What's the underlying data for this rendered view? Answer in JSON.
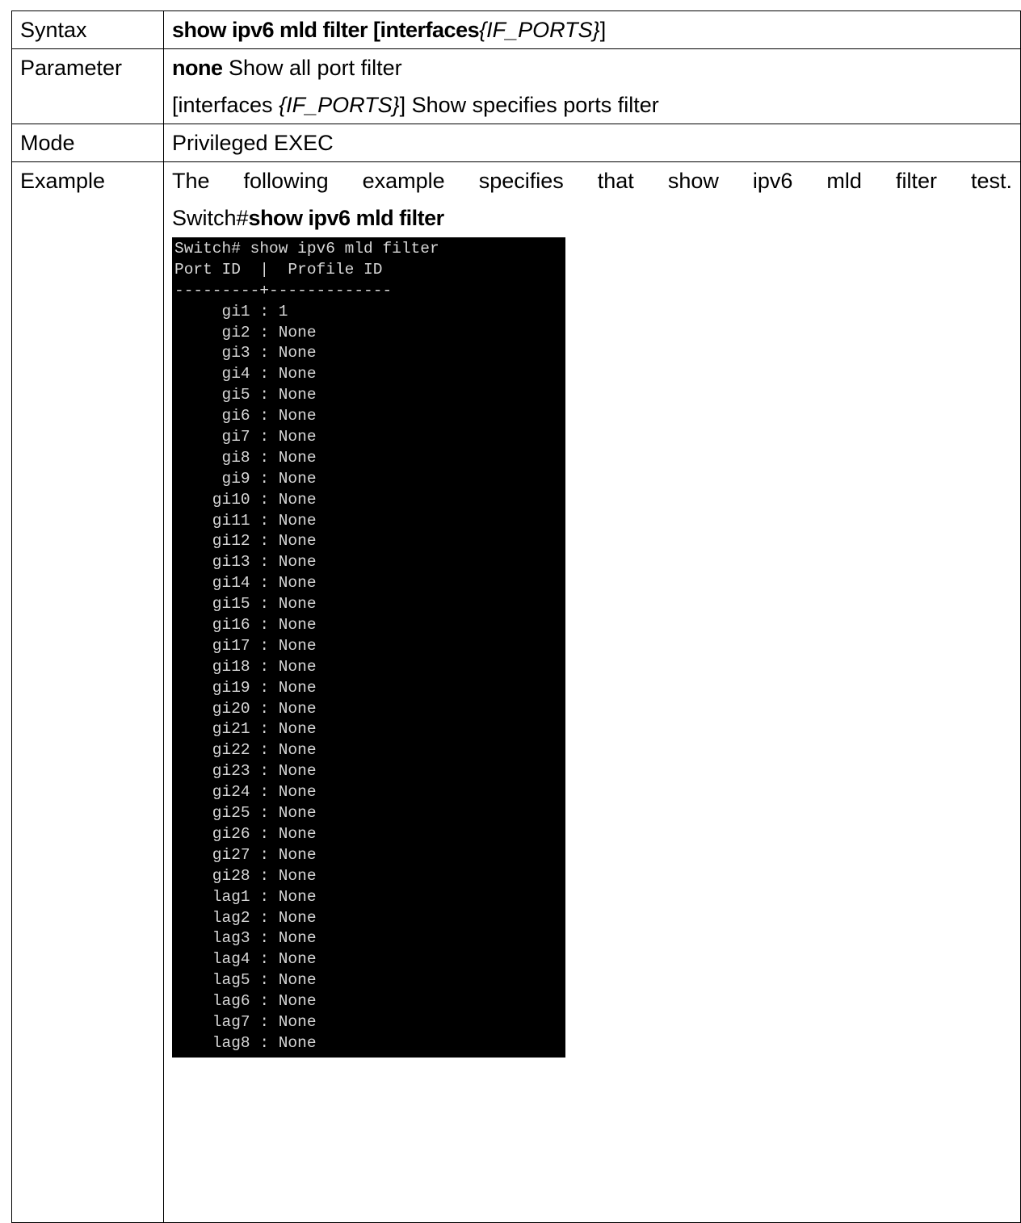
{
  "rows": {
    "syntax": {
      "label": "Syntax",
      "cmd": "show ipv6 mld filter [interfaces",
      "arg": "{IF_PORTS}",
      "close": "]"
    },
    "parameter": {
      "label": "Parameter",
      "line1_kw": "none",
      "line1_desc": " Show all port filter",
      "line2_pre": "[interfaces ",
      "line2_arg": "{IF_PORTS}",
      "line2_post": "] Show specifies ports filter"
    },
    "mode": {
      "label": "Mode",
      "value": "Privileged EXEC"
    },
    "example": {
      "label": "Example",
      "intro": "The following example specifies that show ipv6 mld filter test.",
      "prompt": "Switch#",
      "command": "show ipv6 mld filter"
    }
  },
  "terminal": {
    "lines": [
      "Switch# show ipv6 mld filter",
      "Port ID  |  Profile ID",
      "---------+-------------",
      "     gi1 : 1",
      "     gi2 : None",
      "     gi3 : None",
      "     gi4 : None",
      "     gi5 : None",
      "     gi6 : None",
      "     gi7 : None",
      "     gi8 : None",
      "     gi9 : None",
      "    gi10 : None",
      "    gi11 : None",
      "    gi12 : None",
      "    gi13 : None",
      "    gi14 : None",
      "    gi15 : None",
      "    gi16 : None",
      "    gi17 : None",
      "    gi18 : None",
      "    gi19 : None",
      "    gi20 : None",
      "    gi21 : None",
      "    gi22 : None",
      "    gi23 : None",
      "    gi24 : None",
      "    gi25 : None",
      "    gi26 : None",
      "    gi27 : None",
      "    gi28 : None",
      "    lag1 : None",
      "    lag2 : None",
      "    lag3 : None",
      "    lag4 : None",
      "    lag5 : None",
      "    lag6 : None",
      "    lag7 : None",
      "    lag8 : None"
    ]
  }
}
